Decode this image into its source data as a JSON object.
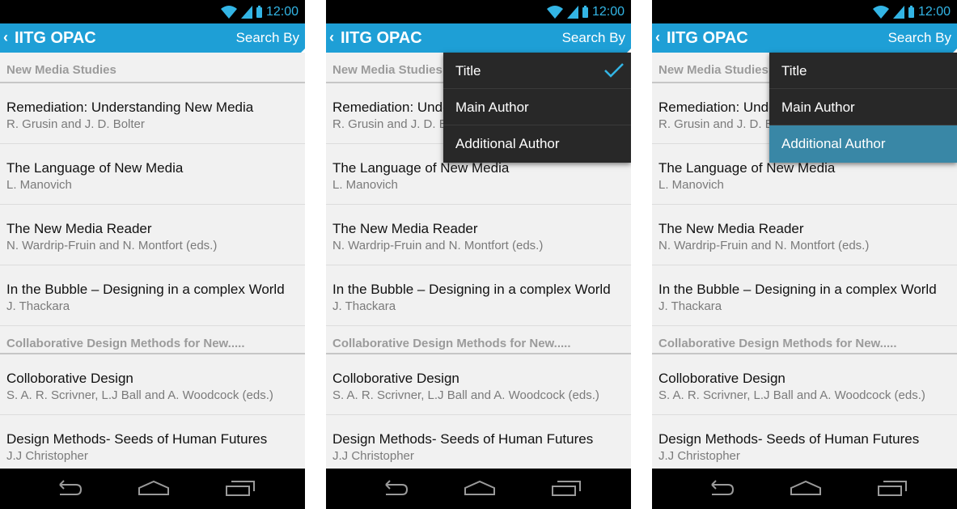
{
  "status": {
    "time": "12:00"
  },
  "app": {
    "title": "IITG OPAC",
    "back_icon": "‹",
    "search_by": "Search By"
  },
  "sections": [
    {
      "header": "New Media Studies",
      "books": [
        {
          "title": "Remediation: Understanding New Media",
          "author": "R. Grusin and J. D. Bolter"
        },
        {
          "title": "The Language of New Media",
          "author": "L. Manovich"
        },
        {
          "title": "The New Media Reader",
          "author": "N. Wardrip-Fruin and N. Montfort (eds.)"
        },
        {
          "title": "In the Bubble – Designing in a complex World",
          "author": "J. Thackara"
        }
      ]
    },
    {
      "header": "Collaborative Design Methods for New.....",
      "books": [
        {
          "title": "Colloborative Design",
          "author": "S. A. R. Scrivner, L.J Ball and A. Woodcock (eds.)"
        },
        {
          "title": "Design Methods- Seeds of Human Futures",
          "author": "J.J Christopher"
        }
      ]
    }
  ],
  "search_menu": {
    "options": [
      "Title",
      "Main Author",
      "Additional Author"
    ]
  },
  "screens": [
    {
      "menu_open": false,
      "selected": null,
      "checked": null
    },
    {
      "menu_open": true,
      "selected": null,
      "checked": "Title"
    },
    {
      "menu_open": true,
      "selected": "Additional Author",
      "checked": null
    }
  ],
  "colors": {
    "action_bar": "#1e9fd6",
    "status_accent": "#33b5e5",
    "menu_bg": "#282828",
    "menu_selected": "#3987a6"
  },
  "icons": [
    "wifi-icon",
    "signal-icon",
    "battery-icon",
    "back-nav-icon",
    "home-nav-icon",
    "recents-nav-icon",
    "check-icon"
  ]
}
